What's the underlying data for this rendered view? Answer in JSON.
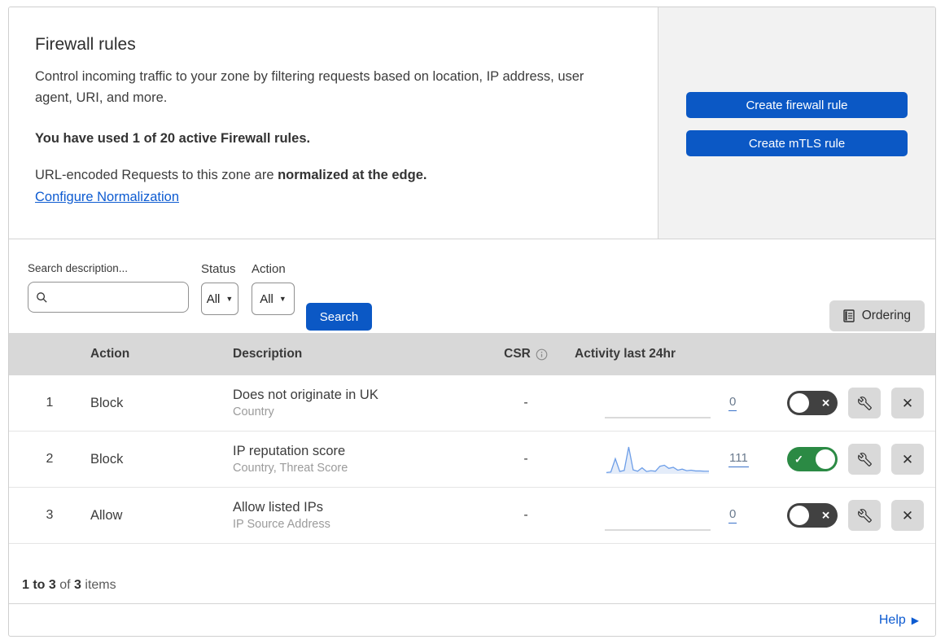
{
  "colors": {
    "accent_blue": "#0b58c5",
    "link_blue": "#0d5bd1",
    "toggle_on_green": "#2b8a44",
    "toggle_off_dark": "#414141",
    "sparkline_blue": "#6d9ee8",
    "sparkline_fill": "#e4ecf9",
    "panel_gray": "#f2f2f2",
    "table_header_gray": "#d8d8d8",
    "icon_button_gray": "#d9d9d9"
  },
  "icons": {
    "caret_glyph": "▼",
    "x_glyph": "✕",
    "check_glyph": "✓",
    "help_arrow_glyph": "▶"
  },
  "header": {
    "title": "Firewall rules",
    "description": "Control incoming traffic to your zone by filtering requests based on location, IP address, user agent, URI, and more.",
    "usage_bold": "You have used 1 of 20 active Firewall rules.",
    "normalization_prefix": "URL-encoded Requests to this zone are ",
    "normalization_bold": "normalized at the edge.",
    "normalization_link": "Configure Normalization",
    "create_firewall_label": "Create firewall rule",
    "create_mtls_label": "Create mTLS rule"
  },
  "filters": {
    "search_label": "Search description...",
    "status_label": "Status",
    "status_value": "All",
    "action_label": "Action",
    "action_value": "All",
    "search_button_label": "Search",
    "ordering_label": "Ordering"
  },
  "table": {
    "columns": {
      "action": "Action",
      "description": "Description",
      "csr": "CSR",
      "activity": "Activity last 24hr"
    },
    "rows": [
      {
        "priority": "1",
        "action": "Block",
        "description": "Does not originate in UK",
        "fields": "Country",
        "csr": "-",
        "activity_count": "0",
        "enabled": false,
        "sparkline": []
      },
      {
        "priority": "2",
        "action": "Block",
        "description": "IP reputation score",
        "fields": "Country, Threat Score",
        "csr": "-",
        "activity_count": "111",
        "enabled": true,
        "sparkline": [
          2,
          4,
          55,
          6,
          10,
          100,
          12,
          7,
          20,
          6,
          9,
          7,
          26,
          30,
          18,
          22,
          11,
          15,
          9,
          11,
          8,
          8,
          7,
          7
        ]
      },
      {
        "priority": "3",
        "action": "Allow",
        "description": "Allow listed IPs",
        "fields": "IP Source Address",
        "csr": "-",
        "activity_count": "0",
        "enabled": false,
        "sparkline": []
      }
    ]
  },
  "footer": {
    "range_text": "1 to 3",
    "of_text": " of ",
    "total_text": "3",
    "items_text": " items",
    "help_label": "Help"
  }
}
